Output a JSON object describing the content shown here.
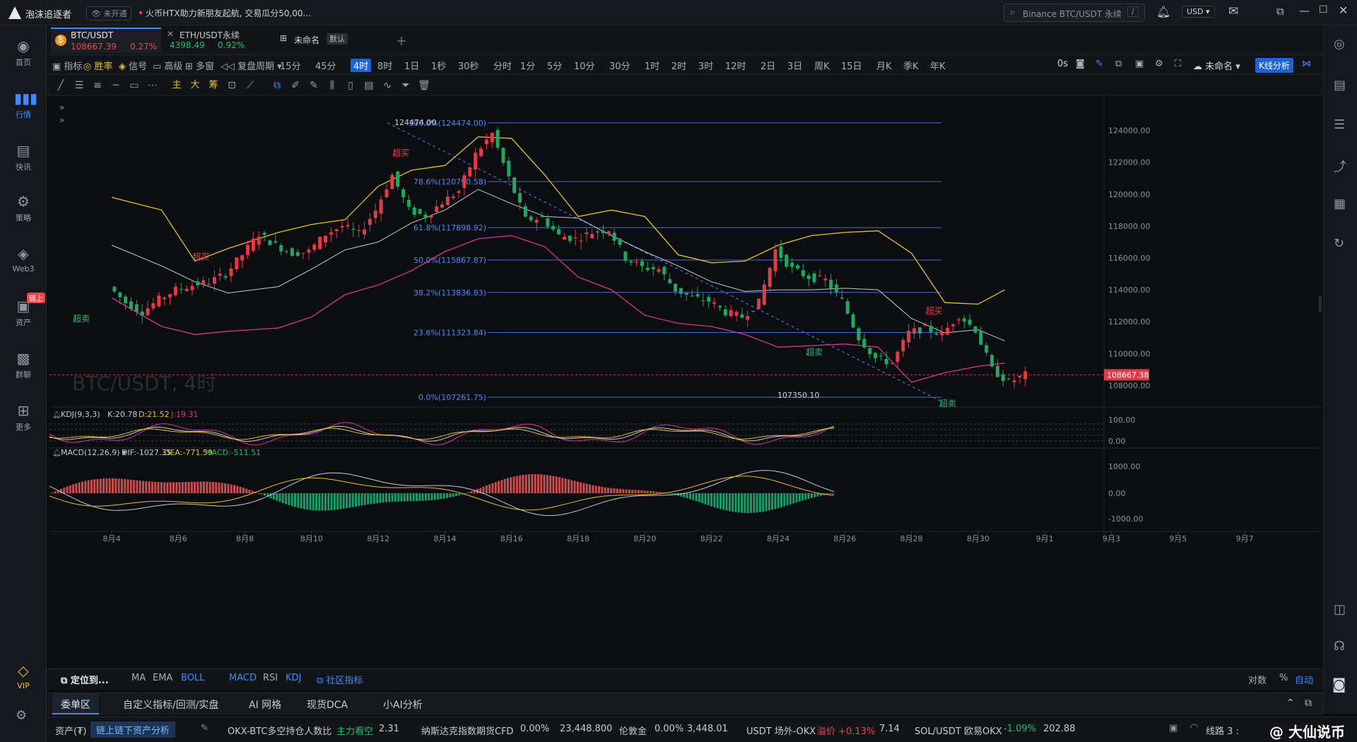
{
  "app": {
    "name": "泡沫追逐者",
    "mode": "未开通",
    "news": "火币HTX助力新朋友起航, 交易瓜分50,00...",
    "search_placeholder": "Binance BTC/USDT 永续",
    "search_shortcut": "/",
    "currency": "USD"
  },
  "nav": [
    {
      "label": "首页",
      "icon": "home-icon"
    },
    {
      "label": "行情",
      "icon": "market-icon"
    },
    {
      "label": "快讯",
      "icon": "news-icon"
    },
    {
      "label": "策略",
      "icon": "strategy-icon"
    },
    {
      "label": "Web3",
      "icon": "web3-icon"
    },
    {
      "label": "资产",
      "icon": "asset-icon",
      "badge": "链上"
    },
    {
      "label": "群聊",
      "icon": "chat-icon"
    },
    {
      "label": "更多",
      "icon": "more-icon"
    },
    {
      "label": "VIP",
      "icon": "vip-icon"
    }
  ],
  "tabs": [
    {
      "symbol": "BTC/USDT",
      "price": "108667.39",
      "change": "0.27%",
      "color": "#f0454f"
    },
    {
      "symbol": "ETH/USDT永续",
      "price": "4398.49",
      "change": "0.92%",
      "color": "#1fbf75"
    }
  ],
  "workspace": {
    "name": "未命名",
    "badge": "默认"
  },
  "toolbar": {
    "items": [
      "指标",
      "胜率",
      "信号",
      "高级",
      "多窗",
      "复盘",
      "周期"
    ],
    "timeframes": [
      "15分",
      "45分",
      "4时",
      "8时",
      "1日",
      "1秒",
      "30秒",
      "分时",
      "1分",
      "5分",
      "10分",
      "30分",
      "1时",
      "2时",
      "3时",
      "12时",
      "2日",
      "3日",
      "周K",
      "15日",
      "月K",
      "季K",
      "年K"
    ],
    "active_tf": "4时",
    "delay": "0s",
    "layout_name": "未命名",
    "kline_btn": "K线分析"
  },
  "drawtools": {
    "main": "主",
    "big": "大",
    "chip": "筹"
  },
  "chart_data": {
    "type": "candlestick",
    "symbol_watermark": "BTC/USDT, 4时",
    "ylim": [
      107000,
      125000
    ],
    "y_ticks": [
      "124000.00",
      "122000.00",
      "120000.00",
      "118000.00",
      "116000.00",
      "114000.00",
      "112000.00",
      "110000.00",
      "108000.00"
    ],
    "x_ticks": [
      "8月4",
      "8月6",
      "8月8",
      "8月10",
      "8月12",
      "8月14",
      "8月16",
      "8月18",
      "8月20",
      "8月22",
      "8月24",
      "8月26",
      "8月28",
      "8月30",
      "9月1",
      "9月3",
      "9月5",
      "9月7"
    ],
    "current_price": "108667.38",
    "high_label": "124474.00",
    "low_label": "107350.10",
    "fib": [
      {
        "label": "100.0%(124474.00)",
        "value": 124474
      },
      {
        "label": "78.6%(120790.58)",
        "value": 120790.58
      },
      {
        "label": "61.8%(117898.92)",
        "value": 117898.92
      },
      {
        "label": "50.0%(115867.87)",
        "value": 115867.87
      },
      {
        "label": "38.2%(113836.83)",
        "value": 113836.83
      },
      {
        "label": "23.6%(111323.84)",
        "value": 111323.84
      },
      {
        "label": "0.0%(107261.75)",
        "value": 107261.75
      }
    ],
    "signals": [
      {
        "text": "超卖",
        "kind": "sell",
        "x": "8月4",
        "y": 112000
      },
      {
        "text": "超买",
        "kind": "buy",
        "x": "8月6",
        "y": 115900
      },
      {
        "text": "超买",
        "kind": "buy",
        "x": "8月12",
        "y": 122400
      },
      {
        "text": "超卖",
        "kind": "sell",
        "x": "8月26",
        "y": 109900
      },
      {
        "text": "超买",
        "kind": "buy",
        "x": "8月28",
        "y": 112500
      },
      {
        "text": "超卖",
        "kind": "sell",
        "x": "8月30",
        "y": 106700
      }
    ],
    "close_path": [
      [
        0,
        114200
      ],
      [
        0.5,
        113200
      ],
      [
        1,
        112600
      ],
      [
        1.5,
        113400
      ],
      [
        2,
        114000
      ],
      [
        2.5,
        114300
      ],
      [
        3,
        114500
      ],
      [
        3.5,
        115000
      ],
      [
        4,
        116200
      ],
      [
        4.5,
        117500
      ],
      [
        5,
        116800
      ],
      [
        5.5,
        116300
      ],
      [
        6,
        116400
      ],
      [
        6.5,
        117500
      ],
      [
        7,
        118000
      ],
      [
        7.5,
        117500
      ],
      [
        8,
        119000
      ],
      [
        8.5,
        121200
      ],
      [
        9,
        119000
      ],
      [
        9.5,
        118600
      ],
      [
        10,
        119500
      ],
      [
        10.5,
        120200
      ],
      [
        11,
        122500
      ],
      [
        11.5,
        123800
      ],
      [
        12,
        121000
      ],
      [
        12.5,
        118400
      ],
      [
        13,
        118500
      ],
      [
        13.5,
        117400
      ],
      [
        14,
        117200
      ],
      [
        14.5,
        117600
      ],
      [
        15,
        117800
      ],
      [
        15.5,
        116000
      ],
      [
        16,
        115400
      ],
      [
        16.5,
        115300
      ],
      [
        17,
        114000
      ],
      [
        17.5,
        113500
      ],
      [
        18,
        113300
      ],
      [
        18.5,
        112600
      ],
      [
        19,
        112300
      ],
      [
        19.5,
        113200
      ],
      [
        20,
        116500
      ],
      [
        20.5,
        115300
      ],
      [
        21,
        114800
      ],
      [
        21.5,
        114600
      ],
      [
        22,
        113300
      ],
      [
        22.5,
        111000
      ],
      [
        23,
        109700
      ],
      [
        23.5,
        109400
      ],
      [
        24,
        111300
      ],
      [
        24.5,
        111600
      ],
      [
        25,
        111200
      ],
      [
        25.5,
        112400
      ],
      [
        26,
        111500
      ],
      [
        26.5,
        109000
      ],
      [
        27,
        108200
      ],
      [
        27.5,
        108667
      ]
    ],
    "boll_upper": [
      [
        0,
        119800
      ],
      [
        1.5,
        119000
      ],
      [
        2.5,
        115800
      ],
      [
        3.5,
        116600
      ],
      [
        5,
        117600
      ],
      [
        6,
        118100
      ],
      [
        7,
        118400
      ],
      [
        8,
        120500
      ],
      [
        9,
        121500
      ],
      [
        10,
        121800
      ],
      [
        11,
        123600
      ],
      [
        12,
        123500
      ],
      [
        13,
        121200
      ],
      [
        14,
        118600
      ],
      [
        15,
        119000
      ],
      [
        16,
        118600
      ],
      [
        17,
        116200
      ],
      [
        18,
        115700
      ],
      [
        19,
        115800
      ],
      [
        20,
        116800
      ],
      [
        21,
        117400
      ],
      [
        22,
        117600
      ],
      [
        23,
        117700
      ],
      [
        24,
        116300
      ],
      [
        25,
        113200
      ],
      [
        26,
        113100
      ],
      [
        26.8,
        114000
      ]
    ],
    "boll_mid": [
      [
        0,
        116800
      ],
      [
        1.5,
        115500
      ],
      [
        2.5,
        114500
      ],
      [
        3.5,
        113800
      ],
      [
        5,
        114200
      ],
      [
        6,
        115300
      ],
      [
        7,
        116500
      ],
      [
        8,
        117000
      ],
      [
        9,
        118200
      ],
      [
        10,
        119000
      ],
      [
        11,
        120300
      ],
      [
        12,
        119400
      ],
      [
        13,
        118600
      ],
      [
        14,
        118500
      ],
      [
        15,
        117400
      ],
      [
        16,
        116400
      ],
      [
        17,
        115500
      ],
      [
        18,
        114500
      ],
      [
        19,
        113900
      ],
      [
        20,
        114000
      ],
      [
        21,
        114000
      ],
      [
        22,
        114100
      ],
      [
        23,
        114000
      ],
      [
        24,
        112200
      ],
      [
        25,
        111300
      ],
      [
        26,
        111500
      ],
      [
        26.8,
        110800
      ]
    ],
    "boll_lower": [
      [
        0,
        113500
      ],
      [
        1.5,
        111700
      ],
      [
        2.5,
        111200
      ],
      [
        3.5,
        111400
      ],
      [
        5,
        111600
      ],
      [
        6,
        112300
      ],
      [
        7,
        113700
      ],
      [
        8,
        114300
      ],
      [
        9,
        115200
      ],
      [
        10,
        116400
      ],
      [
        11,
        117200
      ],
      [
        12,
        117400
      ],
      [
        13,
        116700
      ],
      [
        14,
        114800
      ],
      [
        15,
        114000
      ],
      [
        16,
        112400
      ],
      [
        17,
        111900
      ],
      [
        18,
        111700
      ],
      [
        19,
        111200
      ],
      [
        20,
        110400
      ],
      [
        21,
        110500
      ],
      [
        22,
        110600
      ],
      [
        23,
        110400
      ],
      [
        24,
        108200
      ],
      [
        25,
        108800
      ],
      [
        26,
        109200
      ],
      [
        26.8,
        109400
      ]
    ]
  },
  "kdj": {
    "name": "KDJ(9,3,3)",
    "k": "K:20.78",
    "d": "D:21.52",
    "j": "J:19.31",
    "ticks": [
      "100.00",
      "0.00"
    ]
  },
  "macd": {
    "name": "MACD(12,26,9)",
    "dif": "DIF:-1027.35",
    "dea": "DEA:-771.59",
    "macd": "MACD:-511.51",
    "ticks": [
      "1000.00",
      "0.00",
      "-1000.00"
    ]
  },
  "bottomtools": {
    "locate": "定位到...",
    "indicators": [
      "MA",
      "EMA",
      "BOLL",
      "MACD",
      "RSI",
      "KDJ"
    ],
    "community": "社区指标",
    "scale": "对数",
    "pct": "%",
    "auto": "自动"
  },
  "panels": [
    "委单区",
    "自定义指标/回测/实盘",
    "AI 网格",
    "现货DCA",
    "小AI分析"
  ],
  "status": {
    "assets": "资产(₮)",
    "onchain_btn": "链上链下资产分析",
    "tickers": [
      {
        "name": "OKX-BTC多空持仓人数比",
        "tag": "主力看空",
        "val": "2.31"
      },
      {
        "name": "纳斯达克指数期货CFD",
        "tag": "0.00%",
        "val": "23,448.800"
      },
      {
        "name": "伦敦金",
        "tag": "0.00%",
        "val": "3,448.01"
      },
      {
        "name": "USDT 场外-OKX",
        "tag": "溢价 +0.13%",
        "val": "7.14"
      },
      {
        "name": "SOL/USDT 欧易OKX",
        "tag": "-1.09%",
        "val": "202.88"
      }
    ],
    "line": "线路 3 :",
    "watermark": "@ 大仙说币"
  }
}
